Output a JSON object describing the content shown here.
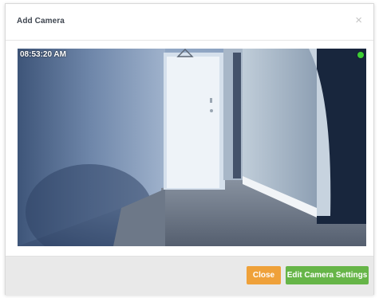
{
  "modal": {
    "title": "Add Camera",
    "close_glyph": "×",
    "close_icon": "close-icon"
  },
  "camera": {
    "timestamp": "08:53:20 AM",
    "status_color": "#3ecf35",
    "status_icon": "live-status-dot"
  },
  "footer": {
    "close_label": "Close",
    "close_color": "#efa13a",
    "edit_label": "Edit Camera Settings",
    "edit_color": "#66b548"
  }
}
